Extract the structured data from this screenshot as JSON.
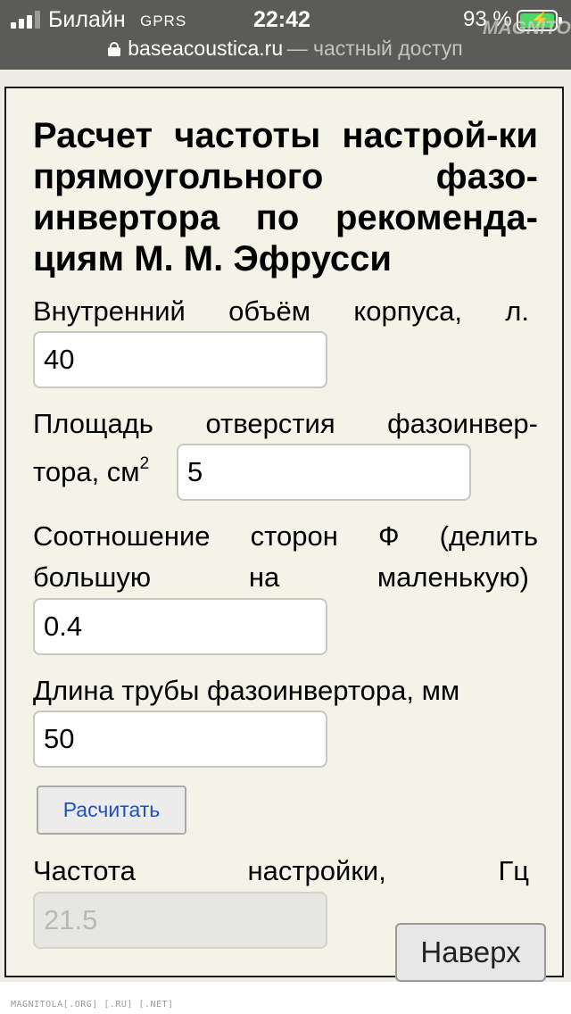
{
  "status_bar": {
    "carrier": "Билайн",
    "network": "GPRS",
    "time": "22:42",
    "battery_percent": "93 %",
    "battery_level": 0.93,
    "signal_bars": 3,
    "url": "baseacoustica.ru",
    "url_suffix": "— частный доступ",
    "watermark": "MAGNITOLA"
  },
  "page": {
    "title": "Расчет частоты настрой-ки прямоугольного фазо-инвертора по рекоменда-циям М. М. Эфрусси",
    "volume_label": "Внутренний объём корпуса, л.",
    "volume_value": "40",
    "area_label": "Площадь отверстия фазоинвер-тора, см",
    "area_unit_sup": "2",
    "area_value": "5",
    "ratio_label": "Соотношение сторон Ф (делить большую на маленькую)",
    "ratio_value": "0.4",
    "tube_label": "Длина трубы фазоинвертора, мм",
    "tube_value": "50",
    "calc_button": "Расчитать",
    "result_label": "Частота настройки, Гц",
    "result_value": "21.5",
    "top_button": "Наверх"
  },
  "footer": "MAGNITOLA[.ORG] [.RU] [.NET]",
  "colors": {
    "status_bar_bg": "#5b5b58",
    "page_bg": "#f4f3e7",
    "battery_green": "#4cd964",
    "link_blue": "#1f4fc4"
  }
}
